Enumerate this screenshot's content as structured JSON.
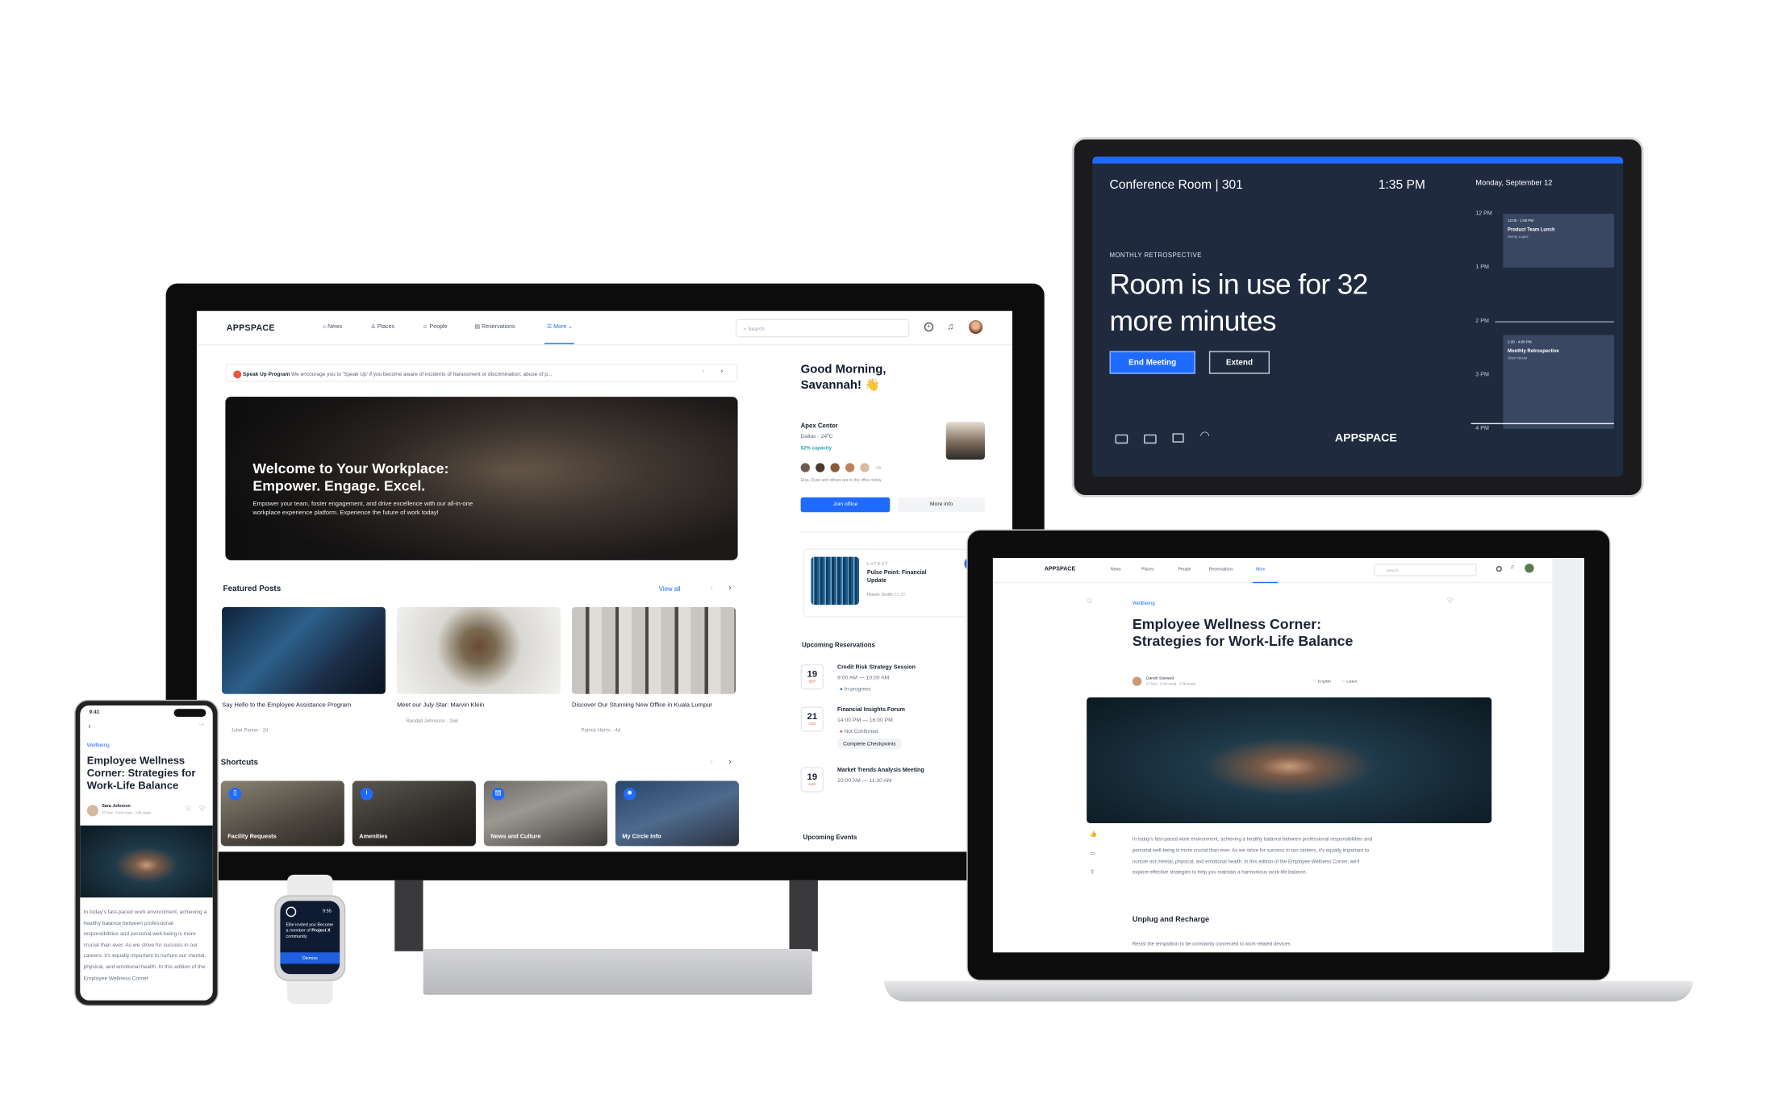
{
  "desktop": {
    "nav": {
      "logo": "APPSPACE",
      "items": [
        {
          "label": "News",
          "icon": "home-icon"
        },
        {
          "label": "Places",
          "icon": "building-icon"
        },
        {
          "label": "People",
          "icon": "people-icon"
        },
        {
          "label": "Reservations",
          "icon": "calendar-icon"
        },
        {
          "label": "More",
          "icon": "menu-icon"
        }
      ],
      "search_placeholder": "Search"
    },
    "banner": {
      "title": "Speak Up Program",
      "text": "We encourage you to 'Speak Up' if you become aware of incidents of harassment or discrimination, abuse of p..."
    },
    "hero": {
      "title": "Welcome to Your Workplace: Empower. Engage. Excel.",
      "body": "Empower your team, foster engagement, and drive excellence with our all-in-one workplace experience platform. Experience the future of work today!"
    },
    "featured": {
      "heading": "Featured Posts",
      "view_all": "View all",
      "posts": [
        {
          "title": "Say Hello to the Employee Assistance Program",
          "meta": "Juliet Parker · 2d"
        },
        {
          "title": "Meet our July Star: Marvin Klein",
          "meta": "Randall Johnsson · 2wk"
        },
        {
          "title": "Discover Our Stunning New Office in Kuala Lumpur",
          "meta": "Patrick Harris · 4d"
        }
      ]
    },
    "shortcuts": {
      "heading": "Shortcuts",
      "items": [
        "Facility Requests",
        "Amenities",
        "News and Culture",
        "My Circle Info"
      ]
    },
    "greeting": "Good Morning, Savannah! 👋",
    "office": {
      "name": "Apex Center",
      "location": "Dallas · 24ºC",
      "capacity": "62% capacity",
      "more_count": "+19",
      "presence": "Elsa, Ryan and others are in the office today",
      "join": "Join office",
      "more_info": "More info"
    },
    "latest": {
      "label": "LATEST",
      "title": "Pulse Point: Financial Update",
      "author": "Howie Smith",
      "duration": "03:30"
    },
    "reservations": {
      "heading": "Upcoming Reservations",
      "items": [
        {
          "day": "19",
          "month": "SEP",
          "title": "Credit Risk Strategy Session",
          "time": "9:00 AM — 10:00 AM",
          "status": "In-progress",
          "status_color": "#1f7fc4"
        },
        {
          "day": "21",
          "month": "AUG",
          "title": "Financial Insights Forum",
          "time": "14:00 PM — 16:00 PM",
          "status": "Not Confirmed",
          "status_color": "#e2483c",
          "action": "Complete Checkpoints"
        },
        {
          "day": "19",
          "month": "AUG",
          "title": "Market Trends Analysis Meeting",
          "time": "10:00 AM — 11:30 AM"
        }
      ]
    },
    "events_heading": "Upcoming Events"
  },
  "tablet": {
    "room": "Conference Room | 301",
    "time": "1:35 PM",
    "date": "Monday, September 12",
    "meeting_label": "MONTHLY RETROSPECTIVE",
    "status": "Room is in use for 32 more minutes",
    "end_meeting": "End Meeting",
    "extend": "Extend",
    "logo": "APPSPACE",
    "hours": [
      "12 PM",
      "1 PM",
      "2 PM",
      "3 PM",
      "4 PM"
    ],
    "events": [
      {
        "time": "12:00 - 1:00 PM",
        "title": "Product Team Lunch",
        "organizer": "Monty Lopez"
      },
      {
        "time": "2:30 - 4:00 PM",
        "title": "Monthly Retrospective",
        "organizer": "Sheri Nicole"
      }
    ],
    "accent": "#1f6bff"
  },
  "laptop": {
    "nav": {
      "logo": "APPSPACE",
      "items": [
        "News",
        "Places",
        "People",
        "Reservations",
        "More"
      ],
      "search_placeholder": "Search"
    },
    "article": {
      "category": "Wellbeing",
      "title": "Employee Wellness Corner: Strategies for Work-Life Balance",
      "author": "Darrell Steward",
      "meta": "27 Nov · 5 min read · 3.5k views",
      "language": "English",
      "listen": "Listen",
      "body": "In today's fast-paced work environment, achieving a healthy balance between professional responsibilities and personal well-being is more crucial than ever. As we strive for success in our careers, it's equally important to nurture our mental, physical, and emotional health. In this edition of the Employee Wellness Corner, we'll explore effective strategies to help you maintain a harmonious work-life balance.",
      "subheading": "Unplug and Recharge",
      "body2": "Resist the temptation to be constantly connected to work-related devices"
    }
  },
  "phone": {
    "clock": "9:41",
    "category": "Wellbeing",
    "title": "Employee Wellness Corner: Strategies for Work-Life Balance",
    "author": "Sara Johnson",
    "meta": "27 Nov · 5 min read · 3.5k views",
    "body": "In today's fast-paced work environment, achieving a healthy balance between professional responsibilities and personal well-being is more crucial than ever. As we strive for success in our careers, it's equally important to nurture our mental, physical, and emotional health. In this edition of the Employee Wellness Corner"
  },
  "watch": {
    "clock": "9:55",
    "message_pre": "Ellie invited you Become a member of",
    "message_bold": "Project X",
    "message_post": "community",
    "dismiss": "Dismiss"
  }
}
